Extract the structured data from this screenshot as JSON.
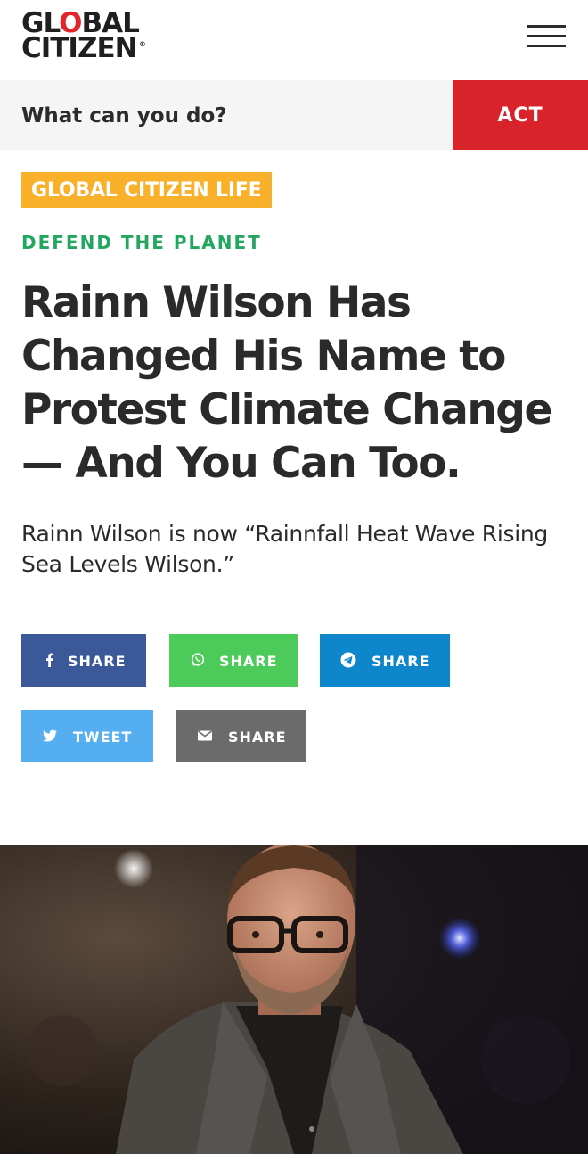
{
  "header": {
    "logo_line1_a": "GL",
    "logo_line1_o": "O",
    "logo_line1_b": "BAL",
    "logo_line2": "CITIZEN",
    "logo_mark": "®",
    "menu_icon": "hamburger-menu-icon"
  },
  "cta": {
    "prompt": "What can you do?",
    "act_label": "ACT"
  },
  "article": {
    "category": "GLOBAL CITIZEN LIFE",
    "subcategory": "DEFEND THE PLANET",
    "headline": "Rainn Wilson Has Changed His Name to Protest Climate Change — And You Can Too.",
    "dek": "Rainn Wilson is now “Rainnfall Heat Wave Rising Sea Levels Wilson.”"
  },
  "share": {
    "facebook": {
      "label": "SHARE",
      "icon": "facebook-icon",
      "color": "#3b5998"
    },
    "whatsapp": {
      "label": "SHARE",
      "icon": "whatsapp-icon",
      "color": "#4ccb5a"
    },
    "telegram": {
      "label": "SHARE",
      "icon": "telegram-icon",
      "color": "#0e86cc"
    },
    "twitter": {
      "label": "TWEET",
      "icon": "twitter-icon",
      "color": "#55aef0"
    },
    "email": {
      "label": "SHARE",
      "icon": "email-icon",
      "color": "#6b6b6b"
    }
  },
  "colors": {
    "brand_red": "#d8232a",
    "category_yellow": "#f9b02b",
    "subcategory_green": "#23a760"
  }
}
